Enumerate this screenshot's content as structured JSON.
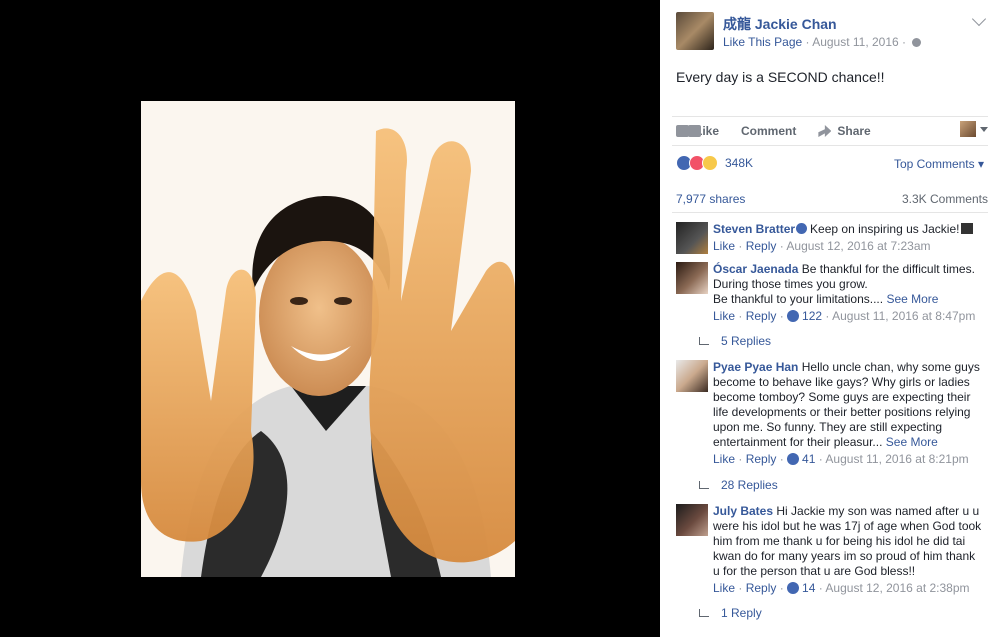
{
  "post": {
    "page_name": "成龍 Jackie Chan",
    "like_page": "Like This Page",
    "date": "August 11, 2016",
    "text": "Every day is a SECOND chance!!"
  },
  "actions": {
    "like": "Like",
    "comment": "Comment",
    "share": "Share"
  },
  "reactions": {
    "count": "348K",
    "sort": "Top Comments"
  },
  "stats": {
    "shares": "7,977 shares",
    "comments": "3.3K Comments"
  },
  "comments": [
    {
      "name": "Steven Bratter",
      "text": "Keep on inspiring us Jackie!",
      "like": "Like",
      "reply": "Reply",
      "time": "August 12, 2016 at 7:23am"
    },
    {
      "name": "Óscar Jaenada",
      "text": "Be thankful for the difficult times. During those times you grow.",
      "text2": "Be thankful to your limitations....",
      "see_more": "See More",
      "like": "Like",
      "reply": "Reply",
      "likes": "122",
      "time": "August 11, 2016 at 8:47pm",
      "replies": "5 Replies"
    },
    {
      "name": "Pyae Pyae Han",
      "text": "Hello uncle chan, why some guys become to behave like gays? Why girls or ladies become tomboy? Some guys are expecting their life developments or their better positions relying upon me. So funny. They are still expecting entertainment for their pleasur...",
      "see_more": "See More",
      "like": "Like",
      "reply": "Reply",
      "likes": "41",
      "time": "August 11, 2016 at 8:21pm",
      "replies": "28 Replies"
    },
    {
      "name": "July Bates",
      "text": "Hi Jackie my son was named after u u were his idol but he was 17j of age when God took him from me thank u for being his idol he did tai kwan do for many years im so proud of him thank u for the person that u are God bless!!",
      "like": "Like",
      "reply": "Reply",
      "likes": "14",
      "time": "August 12, 2016 at 2:38pm",
      "replies": "1 Reply"
    }
  ]
}
